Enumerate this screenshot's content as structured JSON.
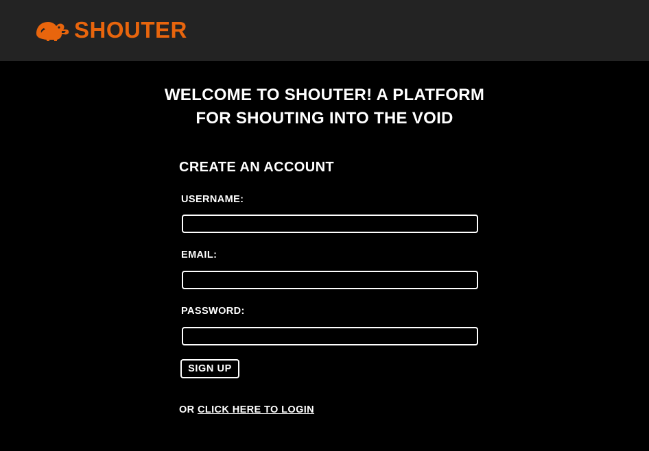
{
  "header": {
    "brand": "SHOUTER",
    "logo_icon": "shouting-creature-icon",
    "brand_color": "#e8650d",
    "background_color": "#232323"
  },
  "welcome": {
    "line1": "WELCOME TO SHOUTER! A PLATFORM",
    "line2": "FOR SHOUTING INTO THE VOID"
  },
  "form": {
    "title": "CREATE AN ACCOUNT",
    "username_label": "USERNAME:",
    "username_value": "",
    "email_label": "EMAIL:",
    "email_value": "",
    "password_label": "PASSWORD:",
    "password_value": "",
    "submit_label": "SIGN UP"
  },
  "login": {
    "prefix": "OR ",
    "link_text": "CLICK HERE TO LOGIN"
  }
}
